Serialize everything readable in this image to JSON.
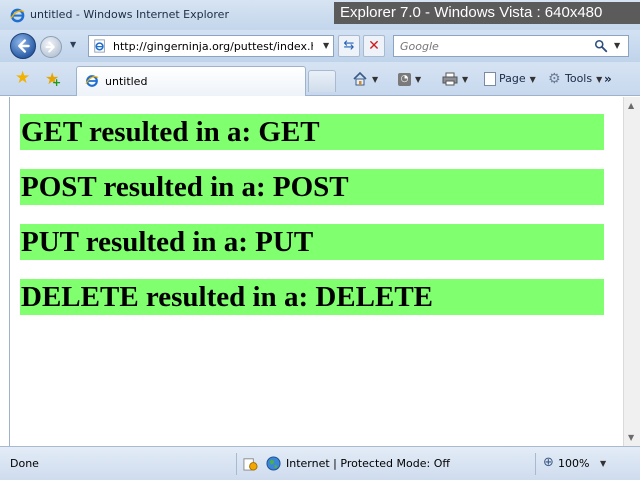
{
  "window": {
    "title": "untitled - Windows Internet Explorer",
    "watermark": "Explorer 7.0 - Windows Vista : 640x480"
  },
  "address_bar": {
    "url": "http://gingerninja.org/puttest/index.h"
  },
  "search": {
    "placeholder": "Google"
  },
  "tab": {
    "label": "untitled"
  },
  "command_bar": {
    "page_label": "Page",
    "tools_label": "Tools",
    "more_label": "»"
  },
  "content": {
    "results": [
      {
        "text": "GET resulted in a: GET"
      },
      {
        "text": "POST resulted in a: POST"
      },
      {
        "text": "PUT resulted in a: PUT"
      },
      {
        "text": "DELETE resulted in a: DELETE"
      }
    ],
    "result_color": "#80ff6f"
  },
  "status": {
    "text": "Done",
    "zone": "Internet | Protected Mode: Off",
    "zoom": "100%"
  },
  "icons": [
    "ie-icon",
    "back-arrow-icon",
    "forward-arrow-icon",
    "refresh-icon",
    "stop-icon",
    "search-icon",
    "favorites-star-icon",
    "add-favorites-icon",
    "home-icon",
    "feed-icon",
    "print-icon",
    "page-icon",
    "gear-icon",
    "lock-icon",
    "globe-icon",
    "zoom-icon"
  ]
}
